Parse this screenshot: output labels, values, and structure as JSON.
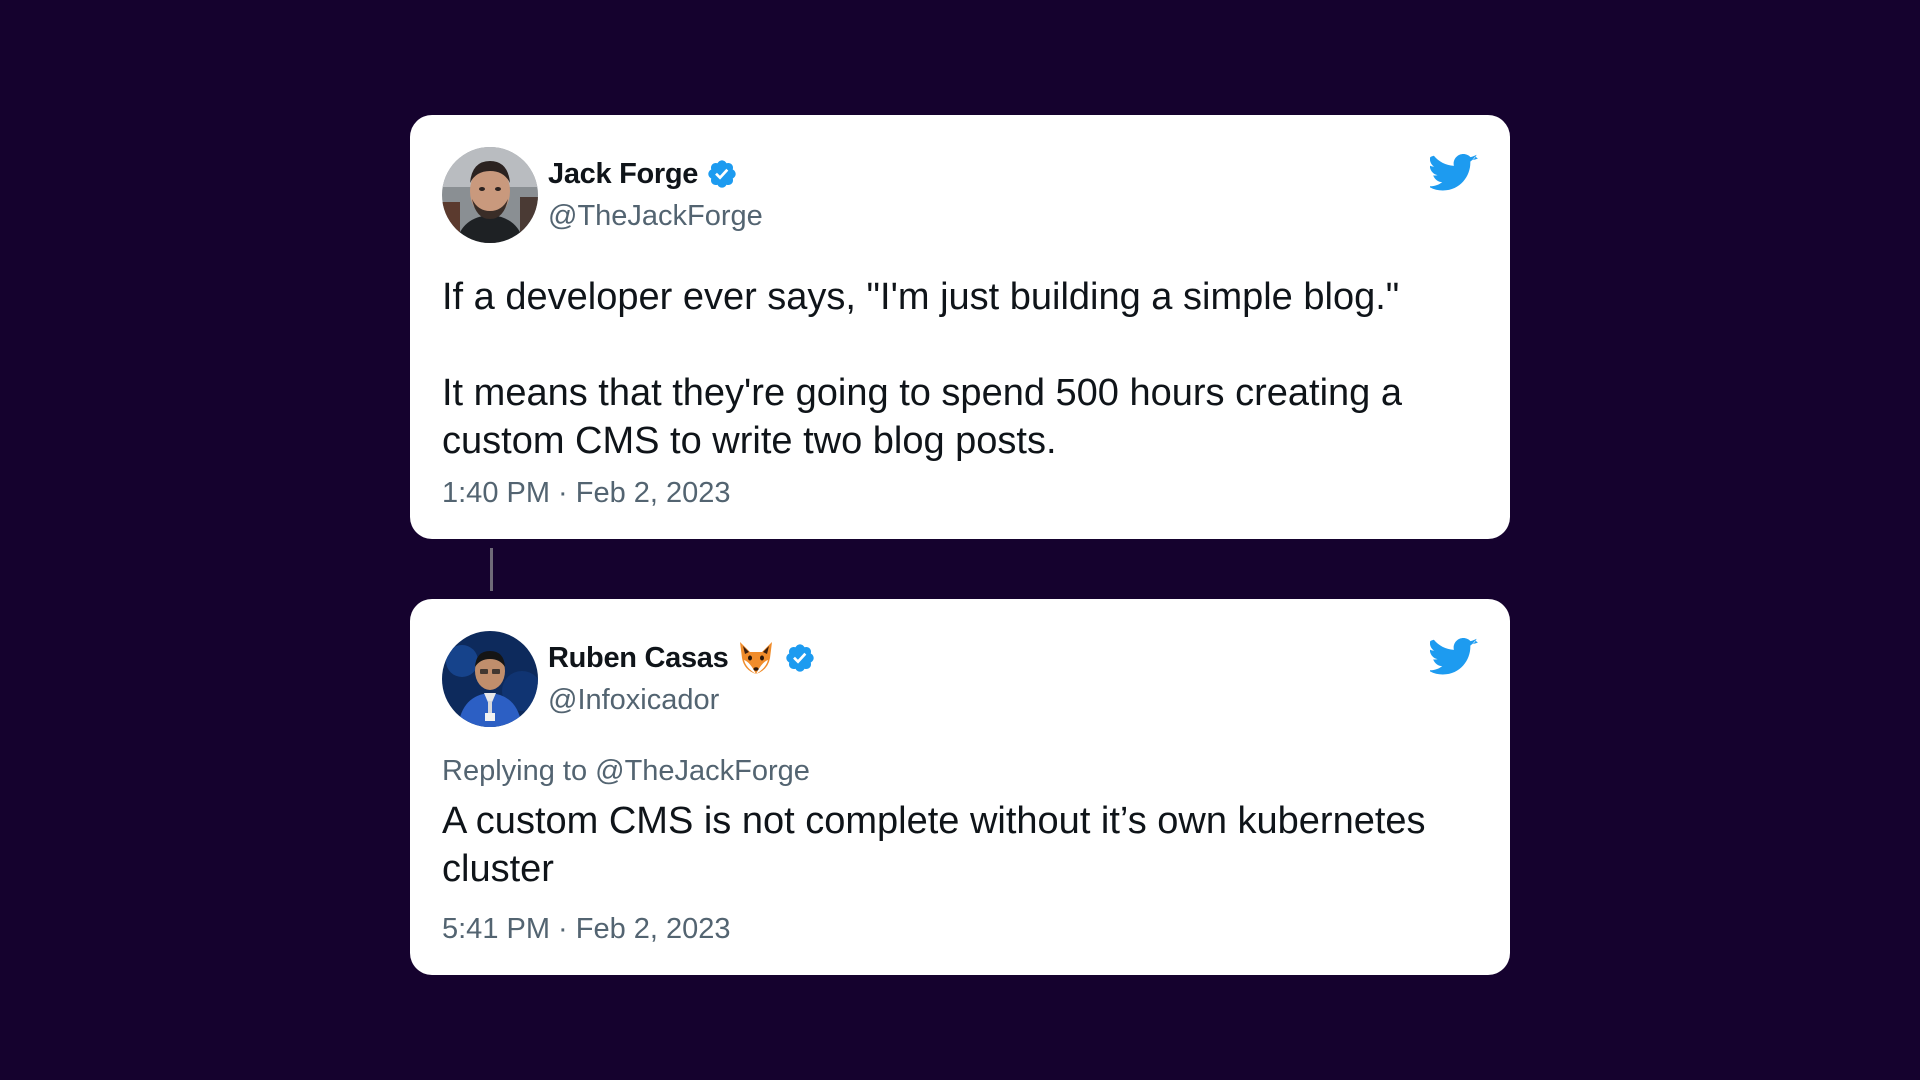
{
  "tweets": [
    {
      "author": {
        "name": "Jack Forge",
        "handle": "@TheJackForge",
        "verified": true
      },
      "text": "If a developer ever says, \"I'm just building a simple blog.\"\n\nIt means that they're going to spend 500 hours creating a custom CMS to write two blog posts.",
      "timestamp": "1:40 PM · Feb 2, 2023"
    },
    {
      "author": {
        "name": "Ruben Casas",
        "emoji": "fox-face-icon",
        "handle": "@Infoxicador",
        "verified": true
      },
      "replying_to": "Replying to @TheJackForge",
      "text": "A custom CMS is not complete without it’s own kubernetes cluster",
      "timestamp": "5:41 PM · Feb 2, 2023"
    }
  ],
  "colors": {
    "background": "#15022e",
    "card": "#ffffff",
    "text": "#0f1419",
    "secondary_text": "#536471",
    "twitter_blue": "#1d9bf0",
    "thread_line": "#6f6a78"
  }
}
